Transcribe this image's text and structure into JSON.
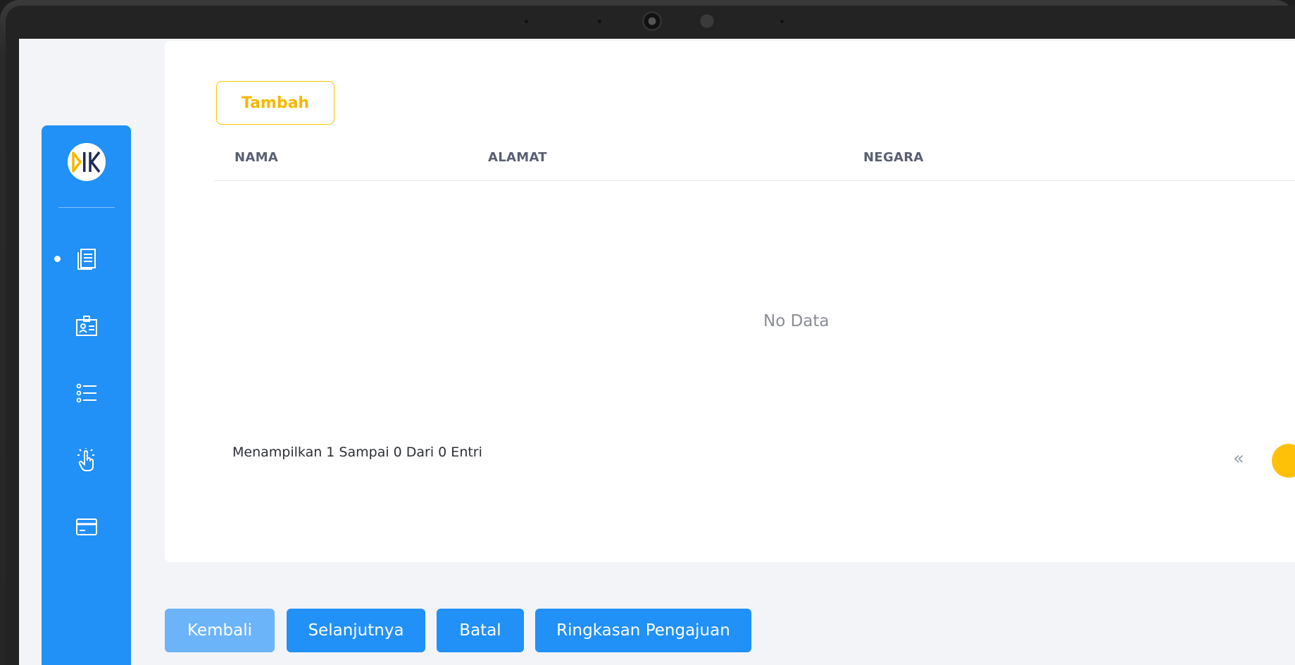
{
  "sidebar": {
    "logo_icon": "brand-logo",
    "items": [
      {
        "icon": "document-icon",
        "active": true
      },
      {
        "icon": "id-card-icon",
        "active": false
      },
      {
        "icon": "list-icon",
        "active": false
      },
      {
        "icon": "tap-hand-icon",
        "active": false
      },
      {
        "icon": "credit-card-icon",
        "active": false
      }
    ]
  },
  "card": {
    "add_label": "Tambah",
    "columns": [
      "NAMA",
      "ALAMAT",
      "NEGARA"
    ],
    "empty_text": "No Data",
    "entries_text": "Menampilkan 1 Sampai 0 Dari 0 Entri"
  },
  "pagination": {
    "prev_icon": "double-chevron-left-icon"
  },
  "footer": {
    "back_label": "Kembali",
    "next_label": "Selanjutnya",
    "cancel_label": "Batal",
    "summary_label": "Ringkasan Pengajuan"
  },
  "colors": {
    "primary": "#2190f7",
    "accent": "#ffc107"
  }
}
